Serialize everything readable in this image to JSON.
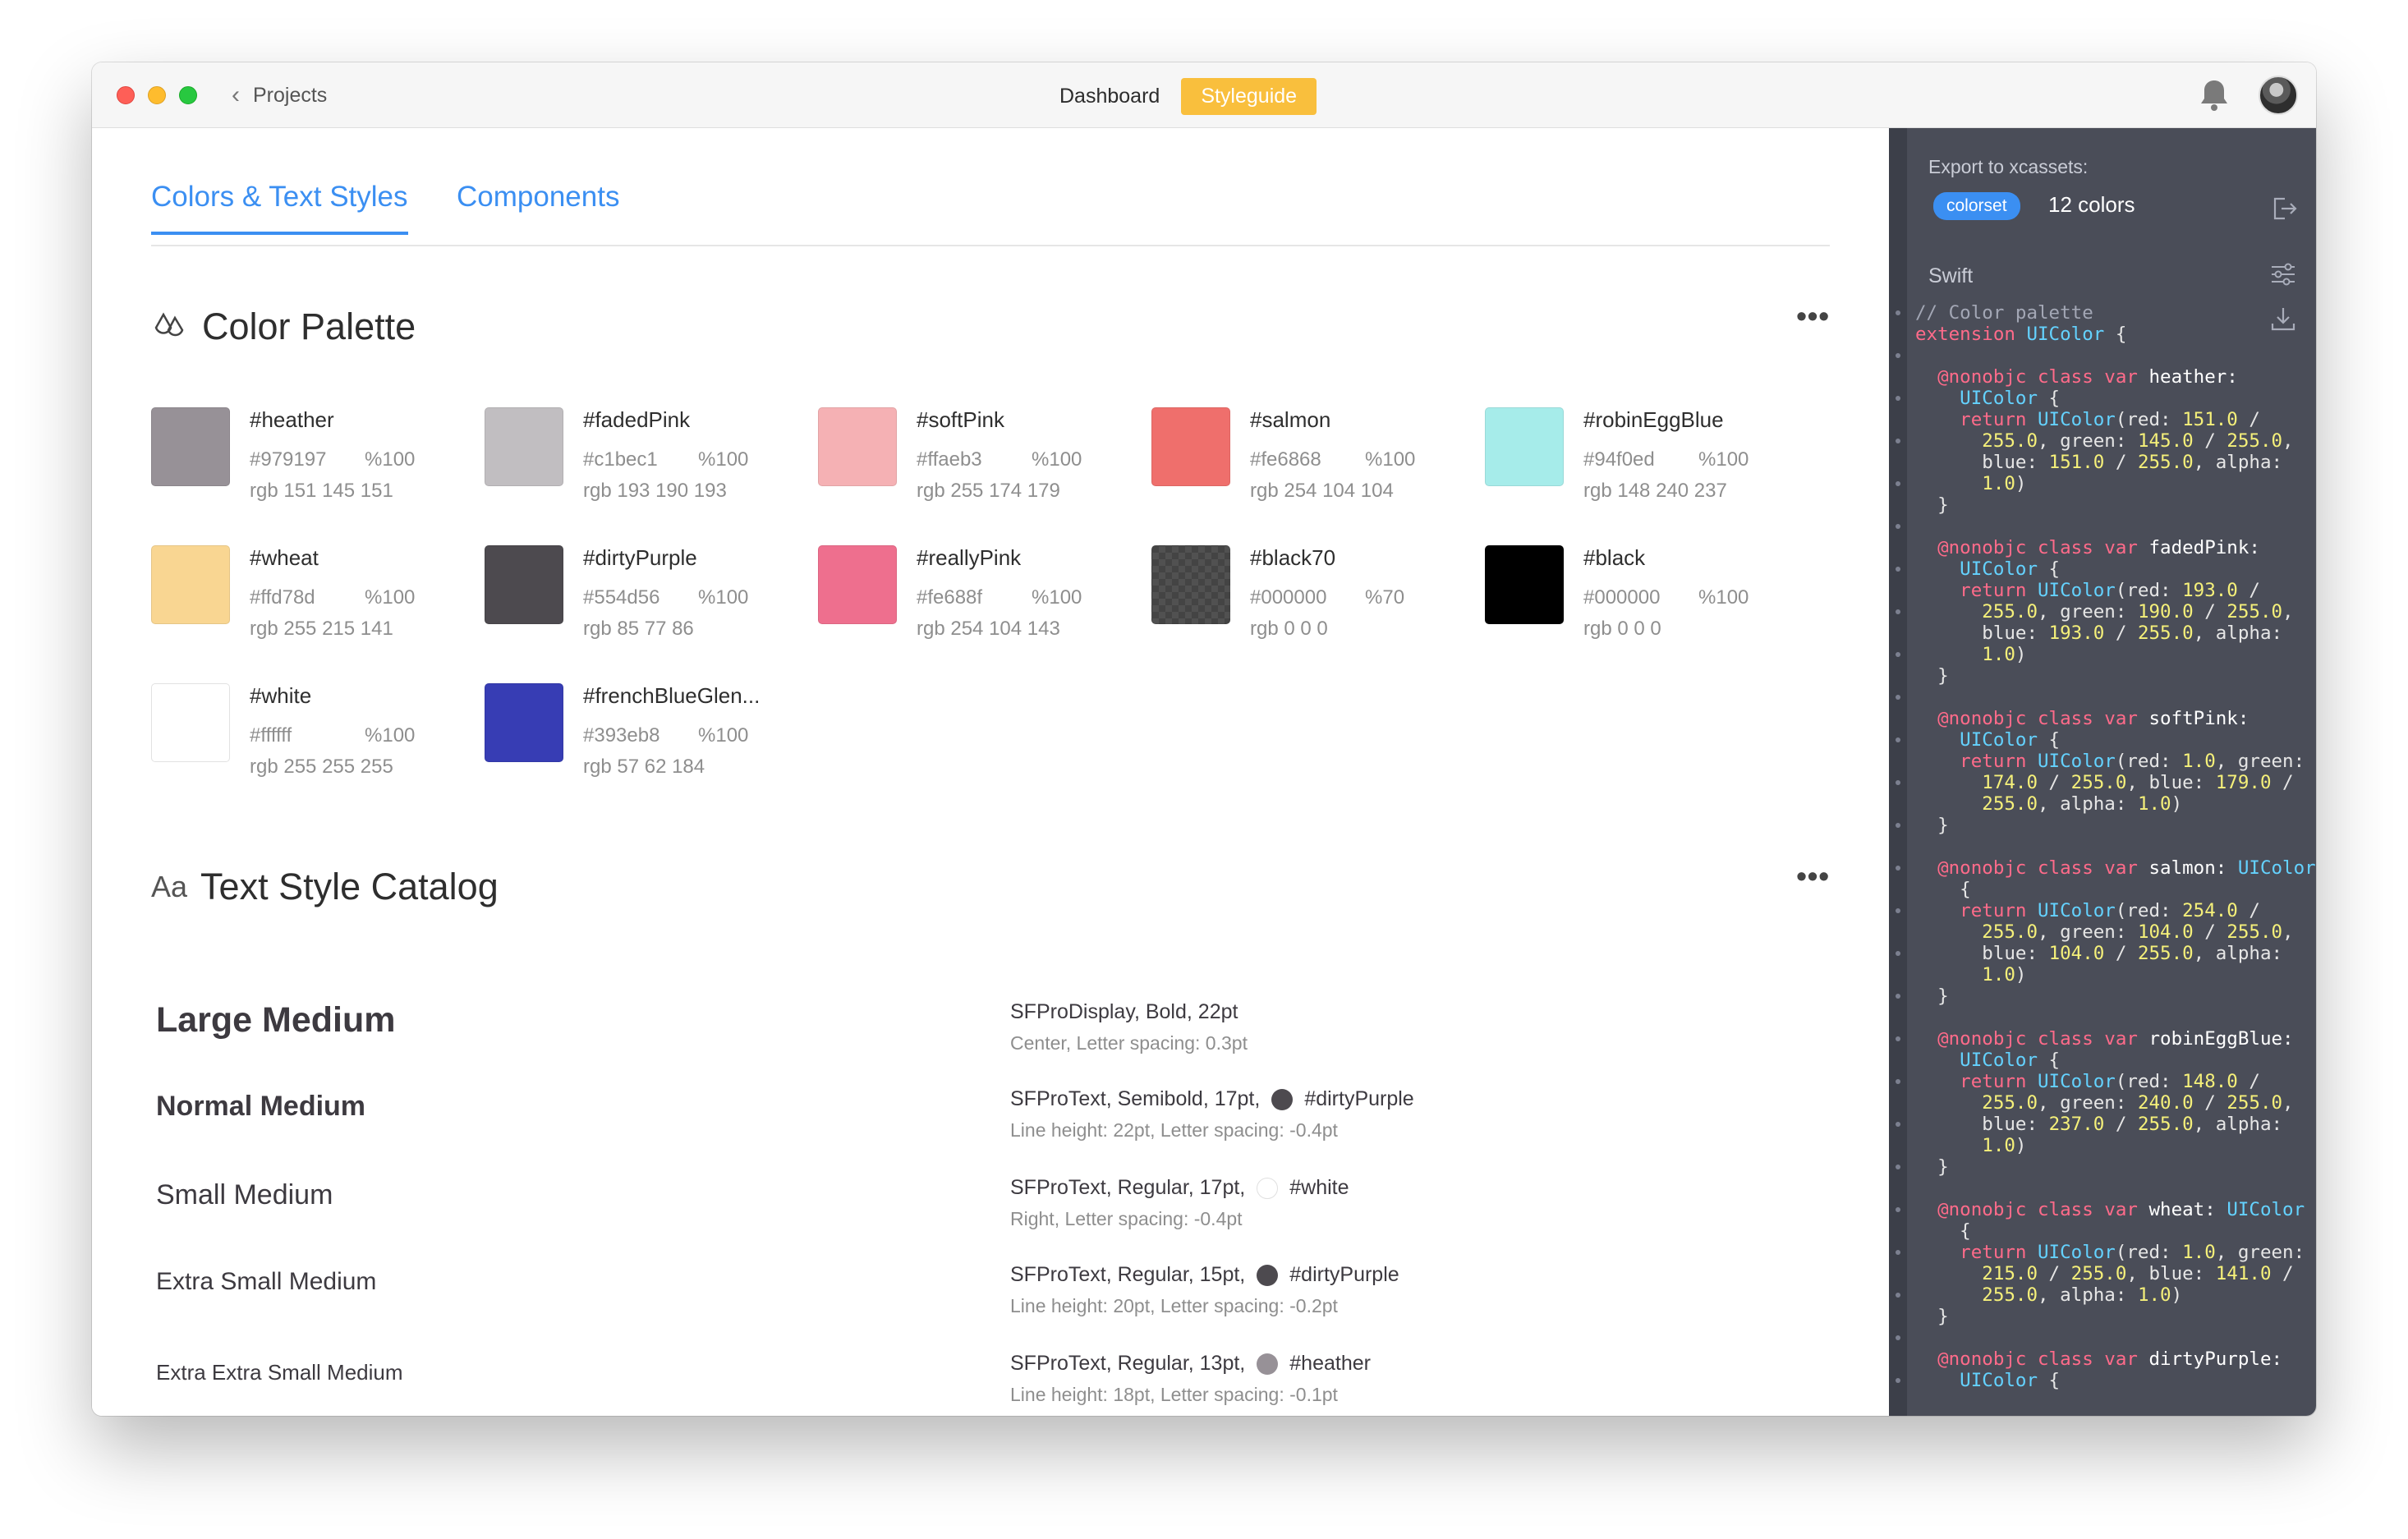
{
  "titlebar": {
    "back_label": "Projects",
    "tabs": [
      {
        "label": "Dashboard",
        "active": false
      },
      {
        "label": "Styleguide",
        "active": true
      }
    ]
  },
  "main": {
    "tabs": [
      {
        "label": "Colors & Text Styles",
        "active": true
      },
      {
        "label": "Components",
        "active": false
      }
    ],
    "color_palette": {
      "title": "Color Palette",
      "colors": [
        {
          "name": "#heather",
          "hex": "#979197",
          "opacity": "%100",
          "rgb": "rgb 151 145 151",
          "color": "#979197"
        },
        {
          "name": "#fadedPink",
          "hex": "#c1bec1",
          "opacity": "%100",
          "rgb": "rgb 193 190 193",
          "color": "#c1bec1"
        },
        {
          "name": "#softPink",
          "hex": "#ffaeb3",
          "opacity": "%100",
          "rgb": "rgb 255 174 179",
          "color": "#f5b1b4"
        },
        {
          "name": "#salmon",
          "hex": "#fe6868",
          "opacity": "%100",
          "rgb": "rgb 254 104 104",
          "color": "#ef6f6c"
        },
        {
          "name": "#robinEggBlue",
          "hex": "#94f0ed",
          "opacity": "%100",
          "rgb": "rgb 148 240 237",
          "color": "#a6ecea"
        },
        {
          "name": "#wheat",
          "hex": "#ffd78d",
          "opacity": "%100",
          "rgb": "rgb 255 215 141",
          "color": "#f9d692"
        },
        {
          "name": "#dirtyPurple",
          "hex": "#554d56",
          "opacity": "%100",
          "rgb": "rgb 85 77 86",
          "color": "#4d4a4f"
        },
        {
          "name": "#reallyPink",
          "hex": "#fe688f",
          "opacity": "%100",
          "rgb": "rgb 254 104 143",
          "color": "#ee6f8e"
        },
        {
          "name": "#black70",
          "hex": "#000000",
          "opacity": "%70",
          "rgb": "rgb 0 0 0",
          "color": "#444444"
        },
        {
          "name": "#black",
          "hex": "#000000",
          "opacity": "%100",
          "rgb": "rgb 0 0 0",
          "color": "#000000"
        },
        {
          "name": "#white",
          "hex": "#ffffff",
          "opacity": "%100",
          "rgb": "rgb 255 255 255",
          "color": "#ffffff"
        },
        {
          "name": "#frenchBlueGlen...",
          "hex": "#393eb8",
          "opacity": "%100",
          "rgb": "rgb 57 62 184",
          "color": "#373db4"
        }
      ]
    },
    "text_styles": {
      "icon_label": "Aa",
      "title": "Text Style Catalog",
      "styles": [
        {
          "sample": "Large Medium",
          "spec": "SFProDisplay, Bold, 22pt",
          "color_name": "",
          "dot_color": "",
          "detail": "Center, Letter spacing: 0.3pt"
        },
        {
          "sample": "Normal Medium",
          "spec": "SFProText, Semibold, 17pt,",
          "color_name": "#dirtyPurple",
          "dot_color": "#4d4a4f",
          "detail": "Line height: 22pt, Letter spacing: -0.4pt"
        },
        {
          "sample": "Small Medium",
          "spec": "SFProText, Regular, 17pt,",
          "color_name": "#white",
          "dot_color": "#ffffff",
          "detail": "Right, Letter spacing: -0.4pt"
        },
        {
          "sample": "Extra Small Medium",
          "spec": "SFProText, Regular, 15pt,",
          "color_name": "#dirtyPurple",
          "dot_color": "#4d4a4f",
          "detail": "Line height: 20pt, Letter spacing: -0.2pt"
        },
        {
          "sample": "Extra Extra Small Medium",
          "spec": "SFProText, Regular, 13pt,",
          "color_name": "#heather",
          "dot_color": "#979197",
          "detail": "Line height: 18pt, Letter spacing: -0.1pt"
        }
      ]
    }
  },
  "panel": {
    "export_label": "Export to xcassets:",
    "badge": "colorset",
    "count": "12 colors",
    "language": "Swift",
    "code_lines": [
      [
        {
          "c": "com",
          "t": "// Color palette"
        }
      ],
      [
        {
          "c": "kw",
          "t": "extension "
        },
        {
          "c": "ty",
          "t": "UIColor"
        },
        {
          "c": "",
          "t": " {"
        }
      ],
      [],
      [
        {
          "c": "kw",
          "t": "  @nonobjc class var "
        },
        {
          "c": "fn",
          "t": "heather:"
        }
      ],
      [
        {
          "c": "ty",
          "t": "    UIColor"
        },
        {
          "c": "",
          "t": " {"
        }
      ],
      [
        {
          "c": "kw",
          "t": "    return "
        },
        {
          "c": "ty",
          "t": "UIColor"
        },
        {
          "c": "",
          "t": "(red: "
        },
        {
          "c": "num",
          "t": "151.0"
        },
        {
          "c": "",
          "t": " /"
        }
      ],
      [
        {
          "c": "num",
          "t": "      255.0"
        },
        {
          "c": "",
          "t": ", green: "
        },
        {
          "c": "num",
          "t": "145.0"
        },
        {
          "c": "",
          "t": " / "
        },
        {
          "c": "num",
          "t": "255.0"
        },
        {
          "c": "",
          "t": ","
        }
      ],
      [
        {
          "c": "",
          "t": "      blue: "
        },
        {
          "c": "num",
          "t": "151.0"
        },
        {
          "c": "",
          "t": " / "
        },
        {
          "c": "num",
          "t": "255.0"
        },
        {
          "c": "",
          "t": ", alpha:"
        }
      ],
      [
        {
          "c": "num",
          "t": "      1.0"
        },
        {
          "c": "",
          "t": ")"
        }
      ],
      [
        {
          "c": "",
          "t": "  }"
        }
      ],
      [],
      [
        {
          "c": "kw",
          "t": "  @nonobjc class var "
        },
        {
          "c": "fn",
          "t": "fadedPink:"
        }
      ],
      [
        {
          "c": "ty",
          "t": "    UIColor"
        },
        {
          "c": "",
          "t": " {"
        }
      ],
      [
        {
          "c": "kw",
          "t": "    return "
        },
        {
          "c": "ty",
          "t": "UIColor"
        },
        {
          "c": "",
          "t": "(red: "
        },
        {
          "c": "num",
          "t": "193.0"
        },
        {
          "c": "",
          "t": " /"
        }
      ],
      [
        {
          "c": "num",
          "t": "      255.0"
        },
        {
          "c": "",
          "t": ", green: "
        },
        {
          "c": "num",
          "t": "190.0"
        },
        {
          "c": "",
          "t": " / "
        },
        {
          "c": "num",
          "t": "255.0"
        },
        {
          "c": "",
          "t": ","
        }
      ],
      [
        {
          "c": "",
          "t": "      blue: "
        },
        {
          "c": "num",
          "t": "193.0"
        },
        {
          "c": "",
          "t": " / "
        },
        {
          "c": "num",
          "t": "255.0"
        },
        {
          "c": "",
          "t": ", alpha:"
        }
      ],
      [
        {
          "c": "num",
          "t": "      1.0"
        },
        {
          "c": "",
          "t": ")"
        }
      ],
      [
        {
          "c": "",
          "t": "  }"
        }
      ],
      [],
      [
        {
          "c": "kw",
          "t": "  @nonobjc class var "
        },
        {
          "c": "fn",
          "t": "softPink:"
        }
      ],
      [
        {
          "c": "ty",
          "t": "    UIColor"
        },
        {
          "c": "",
          "t": " {"
        }
      ],
      [
        {
          "c": "kw",
          "t": "    return "
        },
        {
          "c": "ty",
          "t": "UIColor"
        },
        {
          "c": "",
          "t": "(red: "
        },
        {
          "c": "num",
          "t": "1.0"
        },
        {
          "c": "",
          "t": ", green:"
        }
      ],
      [
        {
          "c": "num",
          "t": "      174.0"
        },
        {
          "c": "",
          "t": " / "
        },
        {
          "c": "num",
          "t": "255.0"
        },
        {
          "c": "",
          "t": ", blue: "
        },
        {
          "c": "num",
          "t": "179.0"
        },
        {
          "c": "",
          "t": " /"
        }
      ],
      [
        {
          "c": "num",
          "t": "      255.0"
        },
        {
          "c": "",
          "t": ", alpha: "
        },
        {
          "c": "num",
          "t": "1.0"
        },
        {
          "c": "",
          "t": ")"
        }
      ],
      [
        {
          "c": "",
          "t": "  }"
        }
      ],
      [],
      [
        {
          "c": "kw",
          "t": "  @nonobjc class var "
        },
        {
          "c": "fn",
          "t": "salmon: "
        },
        {
          "c": "ty",
          "t": "UIColor"
        }
      ],
      [
        {
          "c": "",
          "t": "    {"
        }
      ],
      [
        {
          "c": "kw",
          "t": "    return "
        },
        {
          "c": "ty",
          "t": "UIColor"
        },
        {
          "c": "",
          "t": "(red: "
        },
        {
          "c": "num",
          "t": "254.0"
        },
        {
          "c": "",
          "t": " /"
        }
      ],
      [
        {
          "c": "num",
          "t": "      255.0"
        },
        {
          "c": "",
          "t": ", green: "
        },
        {
          "c": "num",
          "t": "104.0"
        },
        {
          "c": "",
          "t": " / "
        },
        {
          "c": "num",
          "t": "255.0"
        },
        {
          "c": "",
          "t": ","
        }
      ],
      [
        {
          "c": "",
          "t": "      blue: "
        },
        {
          "c": "num",
          "t": "104.0"
        },
        {
          "c": "",
          "t": " / "
        },
        {
          "c": "num",
          "t": "255.0"
        },
        {
          "c": "",
          "t": ", alpha:"
        }
      ],
      [
        {
          "c": "num",
          "t": "      1.0"
        },
        {
          "c": "",
          "t": ")"
        }
      ],
      [
        {
          "c": "",
          "t": "  }"
        }
      ],
      [],
      [
        {
          "c": "kw",
          "t": "  @nonobjc class var "
        },
        {
          "c": "fn",
          "t": "robinEggBlue:"
        }
      ],
      [
        {
          "c": "ty",
          "t": "    UIColor"
        },
        {
          "c": "",
          "t": " {"
        }
      ],
      [
        {
          "c": "kw",
          "t": "    return "
        },
        {
          "c": "ty",
          "t": "UIColor"
        },
        {
          "c": "",
          "t": "(red: "
        },
        {
          "c": "num",
          "t": "148.0"
        },
        {
          "c": "",
          "t": " /"
        }
      ],
      [
        {
          "c": "num",
          "t": "      255.0"
        },
        {
          "c": "",
          "t": ", green: "
        },
        {
          "c": "num",
          "t": "240.0"
        },
        {
          "c": "",
          "t": " / "
        },
        {
          "c": "num",
          "t": "255.0"
        },
        {
          "c": "",
          "t": ","
        }
      ],
      [
        {
          "c": "",
          "t": "      blue: "
        },
        {
          "c": "num",
          "t": "237.0"
        },
        {
          "c": "",
          "t": " / "
        },
        {
          "c": "num",
          "t": "255.0"
        },
        {
          "c": "",
          "t": ", alpha:"
        }
      ],
      [
        {
          "c": "num",
          "t": "      1.0"
        },
        {
          "c": "",
          "t": ")"
        }
      ],
      [
        {
          "c": "",
          "t": "  }"
        }
      ],
      [],
      [
        {
          "c": "kw",
          "t": "  @nonobjc class var "
        },
        {
          "c": "fn",
          "t": "wheat: "
        },
        {
          "c": "ty",
          "t": "UIColor"
        }
      ],
      [
        {
          "c": "",
          "t": "    {"
        }
      ],
      [
        {
          "c": "kw",
          "t": "    return "
        },
        {
          "c": "ty",
          "t": "UIColor"
        },
        {
          "c": "",
          "t": "(red: "
        },
        {
          "c": "num",
          "t": "1.0"
        },
        {
          "c": "",
          "t": ", green:"
        }
      ],
      [
        {
          "c": "num",
          "t": "      215.0"
        },
        {
          "c": "",
          "t": " / "
        },
        {
          "c": "num",
          "t": "255.0"
        },
        {
          "c": "",
          "t": ", blue: "
        },
        {
          "c": "num",
          "t": "141.0"
        },
        {
          "c": "",
          "t": " /"
        }
      ],
      [
        {
          "c": "num",
          "t": "      255.0"
        },
        {
          "c": "",
          "t": ", alpha: "
        },
        {
          "c": "num",
          "t": "1.0"
        },
        {
          "c": "",
          "t": ")"
        }
      ],
      [
        {
          "c": "",
          "t": "  }"
        }
      ],
      [],
      [
        {
          "c": "kw",
          "t": "  @nonobjc class var "
        },
        {
          "c": "fn",
          "t": "dirtyPurple:"
        }
      ],
      [
        {
          "c": "ty",
          "t": "    UIColor"
        },
        {
          "c": "",
          "t": " {"
        }
      ]
    ]
  },
  "colors": {
    "accent": "#3b8ff2",
    "styleguide_tab": "#f9bf3d",
    "panel_bg": "#4a4d58"
  }
}
